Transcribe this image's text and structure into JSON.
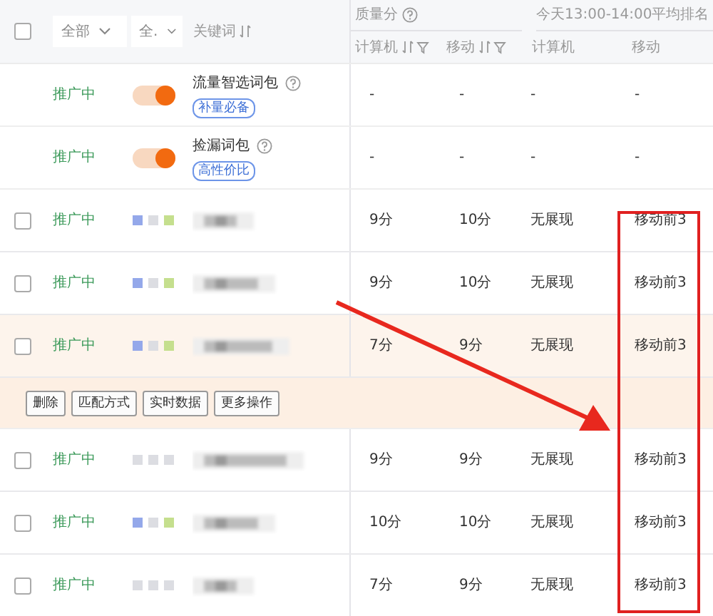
{
  "header": {
    "checked": false,
    "filters": [
      {
        "label": "全部"
      },
      {
        "label": "全."
      }
    ],
    "keyword_label": "关键词",
    "quality": {
      "title": "质量分",
      "columns": [
        "计算机",
        "移动"
      ]
    },
    "rank": {
      "title": "今天13:00-14:00平均排名",
      "columns": [
        "计算机",
        "移动"
      ]
    }
  },
  "rows": [
    {
      "kind": "package",
      "status": "推广中",
      "on": true,
      "name": "流量智选词包",
      "tag": "补量必备",
      "q_pc": "-",
      "q_mobile": "-",
      "r_pc": "-",
      "r_mobile": "-"
    },
    {
      "kind": "package",
      "status": "推广中",
      "on": true,
      "name": "捡漏词包",
      "tag": "高性价比",
      "q_pc": "-",
      "q_mobile": "-",
      "r_pc": "-",
      "r_mobile": "-"
    },
    {
      "kind": "keyword",
      "checked": false,
      "selected": false,
      "status": "推广中",
      "indicators": [
        {
          "color": "#94a8ea"
        },
        {
          "color": "#dcdde2"
        },
        {
          "color": "#c5df8e"
        }
      ],
      "q_pc": "9分",
      "q_mobile": "10分",
      "r_pc": "无展现",
      "r_mobile": "移动前3"
    },
    {
      "kind": "keyword",
      "checked": false,
      "selected": false,
      "status": "推广中",
      "indicators": [
        {
          "color": "#94a8ea"
        },
        {
          "color": "#dcdde2"
        },
        {
          "color": "#c5df8e"
        }
      ],
      "q_pc": "9分",
      "q_mobile": "10分",
      "r_pc": "无展现",
      "r_mobile": "移动前3"
    },
    {
      "kind": "keyword",
      "checked": false,
      "selected": true,
      "status": "推广中",
      "indicators": [
        {
          "color": "#94a8ea"
        },
        {
          "color": "#dcdde2"
        },
        {
          "color": "#c5df8e"
        }
      ],
      "q_pc": "7分",
      "q_mobile": "9分",
      "r_pc": "无展现",
      "r_mobile": "移动前3"
    },
    {
      "kind": "actions",
      "buttons": [
        "删除",
        "匹配方式",
        "实时数据",
        "更多操作"
      ]
    },
    {
      "kind": "keyword",
      "checked": false,
      "selected": false,
      "status": "推广中",
      "indicators": [
        {
          "color": "#dcdde2"
        },
        {
          "color": "#dcdde2"
        },
        {
          "color": "#dcdde2"
        }
      ],
      "q_pc": "9分",
      "q_mobile": "9分",
      "r_pc": "无展现",
      "r_mobile": "移动前3"
    },
    {
      "kind": "keyword",
      "checked": false,
      "selected": false,
      "status": "推广中",
      "indicators": [
        {
          "color": "#94a8ea"
        },
        {
          "color": "#dcdde2"
        },
        {
          "color": "#c5df8e"
        }
      ],
      "q_pc": "10分",
      "q_mobile": "10分",
      "r_pc": "无展现",
      "r_mobile": "移动前3"
    },
    {
      "kind": "keyword",
      "checked": false,
      "selected": false,
      "status": "推广中",
      "indicators": [
        {
          "color": "#dcdde2"
        },
        {
          "color": "#dcdde2"
        },
        {
          "color": "#dcdde2"
        }
      ],
      "q_pc": "7分",
      "q_mobile": "9分",
      "r_pc": "无展现",
      "r_mobile": "移动前3"
    }
  ],
  "annotations": {
    "highlight_box": true,
    "arrow": true
  }
}
